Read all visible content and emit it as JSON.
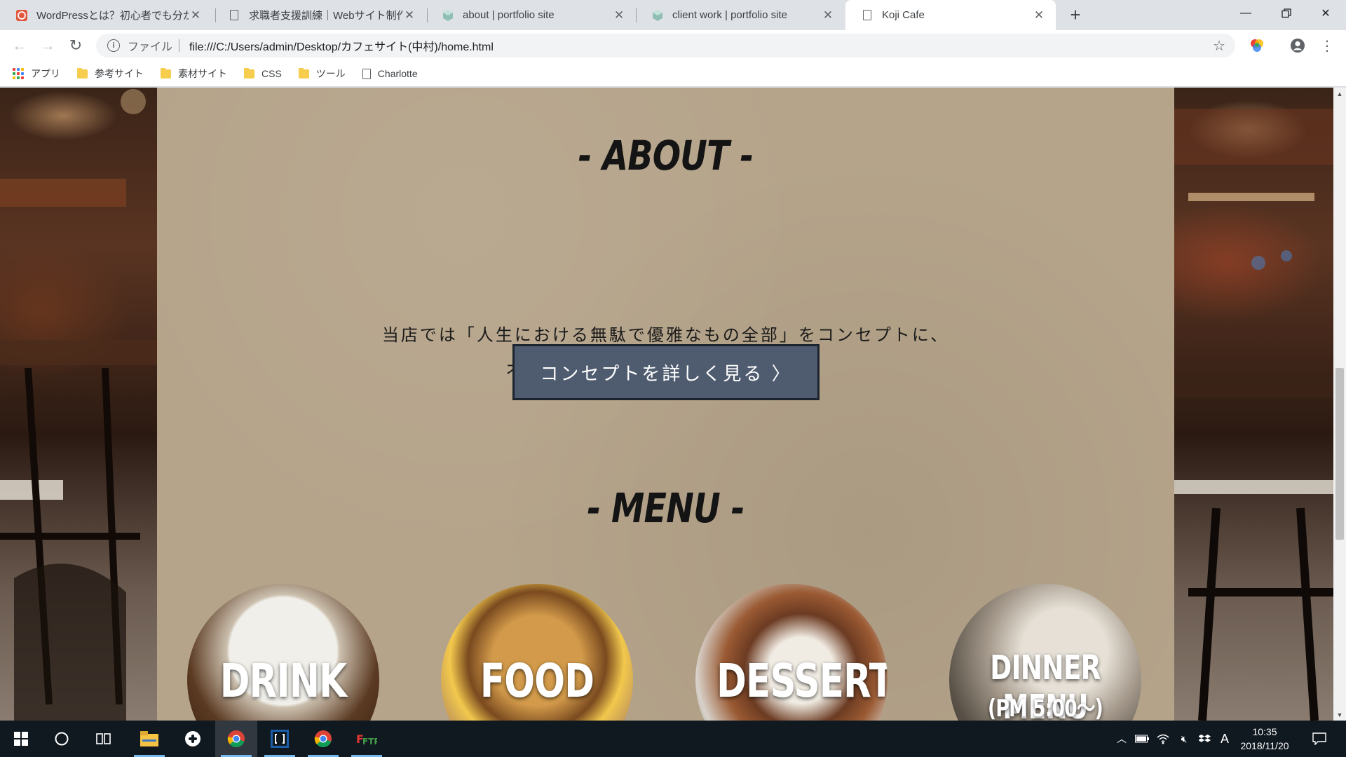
{
  "browser": {
    "tabs": [
      {
        "title": "WordPressとは？初心者でも分かる",
        "favicon": "wordpress-favicon",
        "active": false
      },
      {
        "title": "求職者支援訓練｜Webサイト制作",
        "favicon": "document-favicon",
        "active": false
      },
      {
        "title": "about | portfolio site",
        "favicon": "cube-favicon",
        "active": false
      },
      {
        "title": "client work | portfolio site",
        "favicon": "cube-favicon",
        "active": false
      },
      {
        "title": "Koji Cafe",
        "favicon": "document-favicon",
        "active": true
      }
    ],
    "omnibox": {
      "scheme_label": "ファイル",
      "url": "file:///C:/Users/admin/Desktop/カフェサイト(中村)/home.html"
    },
    "bookmarks": [
      {
        "label": "アプリ",
        "icon": "apps-icon"
      },
      {
        "label": "参考サイト",
        "icon": "folder-icon"
      },
      {
        "label": "素材サイト",
        "icon": "folder-icon"
      },
      {
        "label": "CSS",
        "icon": "folder-icon"
      },
      {
        "label": "ツール",
        "icon": "folder-icon"
      },
      {
        "label": "Charlotte",
        "icon": "page-icon"
      }
    ]
  },
  "page": {
    "about": {
      "heading": "- ABOUT -",
      "line1": "当店では「人生における無駄で優雅なもの全部」をコンセプトに、",
      "line2": "オシャレな大人の空間を提供します。",
      "button": "コンセプトを詳しく見る 〉"
    },
    "menu": {
      "heading": "- MENU -",
      "items": [
        {
          "label": "DRINK",
          "sub": ""
        },
        {
          "label": "FOOD",
          "sub": ""
        },
        {
          "label": "DESSERT",
          "sub": ""
        },
        {
          "label": "DINNER MENU",
          "sub": "(PM 5:00〜)"
        }
      ]
    }
  },
  "taskbar": {
    "clock_time": "10:35",
    "clock_date": "2018/11/20",
    "ime_label": "A"
  },
  "colors": {
    "paper": "#b5a48a",
    "button_bg": "#4f5c6f",
    "taskbar": "#101820",
    "accent_running": "#76b9ed"
  }
}
